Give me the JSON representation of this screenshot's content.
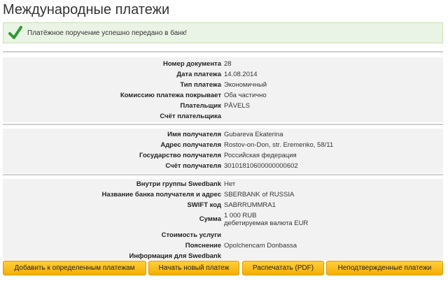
{
  "page": {
    "title": "Международные платежи"
  },
  "alert": {
    "message": "Платёжное поручение успешно передано в банк!",
    "icon": "check-icon",
    "color": "#2e9b35"
  },
  "payment": {
    "document_number_label": "Номер документа",
    "document_number": "28",
    "date_label": "Дата платежа",
    "date": "14.08.2014",
    "type_label": "Тип платежа",
    "type": "Экономичный",
    "commission_label": "Комиссию платежа покрывает",
    "commission": "Оба частично",
    "payer_label": "Плательщик",
    "payer": "PĀVELS",
    "payer_account_label": "Счёт плательщика",
    "payer_account": ""
  },
  "recipient": {
    "name_label": "Имя получателя",
    "name": "Gubareva Ekaterina",
    "address_label": "Адрес получателя",
    "address": "Rostov-on-Don, str. Eremenko, 58/11",
    "country_label": "Государство получателя",
    "country": "Российская федерация",
    "account_label": "Счёт получателя",
    "account": "30101810600000000602"
  },
  "bank": {
    "within_group_label": "Внутри группы Swedbank",
    "within_group": "Нет",
    "bank_name_label": "Название банка получателя и адрес",
    "bank_name": "SBERBANK of RUSSIA",
    "swift_label": "SWIFT код",
    "swift": "SABRRUMMRA1",
    "amount_label": "Сумма",
    "amount_line1": "1 000 RUB",
    "amount_line2": "дебетируемая валюта EUR",
    "service_cost_label": "Стоимость услуги",
    "service_cost": "",
    "explanation_label": "Пояснение",
    "explanation": "Opolchencam Donbassa",
    "info_label": "Информация для Swedbank",
    "info": ""
  },
  "buttons": {
    "add_to_defined": "Добавить к определенным платежам",
    "new_payment": "Начать новый платеж",
    "print_pdf": "Распечатать (PDF)",
    "unconfirmed": "Неподтвержденные платежи"
  }
}
